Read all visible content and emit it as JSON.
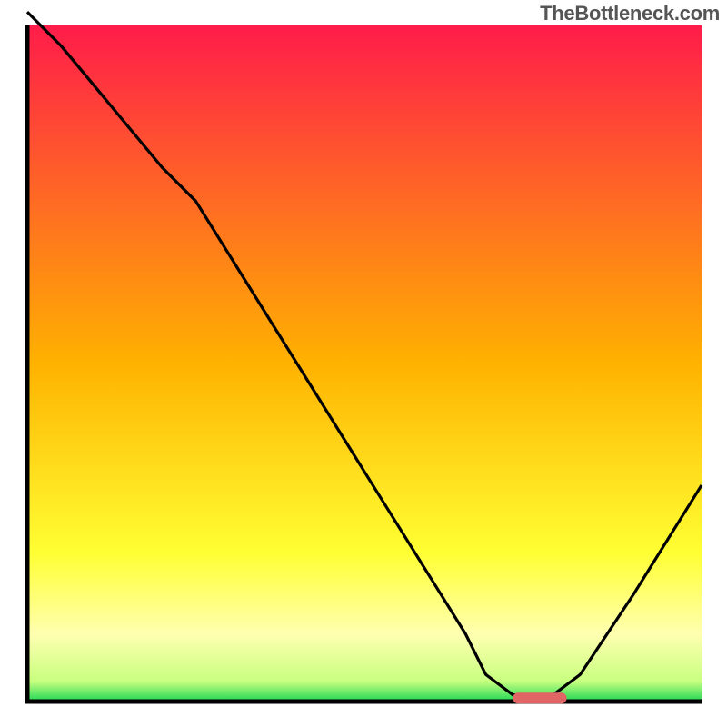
{
  "watermark": "TheBottleneck.com",
  "chart_data": {
    "type": "line",
    "title": "",
    "xlabel": "",
    "ylabel": "",
    "xlim": [
      0,
      100
    ],
    "ylim": [
      0,
      100
    ],
    "x": [
      0,
      5,
      10,
      15,
      20,
      25,
      30,
      35,
      40,
      45,
      50,
      55,
      60,
      65,
      68,
      72,
      75,
      78,
      82,
      86,
      90,
      95,
      100
    ],
    "values": [
      102,
      97,
      91,
      85,
      79,
      74,
      66,
      58,
      50,
      42,
      34,
      26,
      18,
      10,
      4,
      1,
      1,
      1,
      4,
      10,
      16,
      24,
      32
    ],
    "marker": {
      "x_range": [
        72,
        80
      ],
      "y": 0.5,
      "color": "#e06666"
    },
    "gradient_stops": [
      {
        "offset": 0.0,
        "color": "#ff1c4a"
      },
      {
        "offset": 0.5,
        "color": "#ffb200"
      },
      {
        "offset": 0.78,
        "color": "#ffff33"
      },
      {
        "offset": 0.9,
        "color": "#ffffb0"
      },
      {
        "offset": 0.97,
        "color": "#c8ff80"
      },
      {
        "offset": 1.0,
        "color": "#1fd655"
      }
    ]
  }
}
